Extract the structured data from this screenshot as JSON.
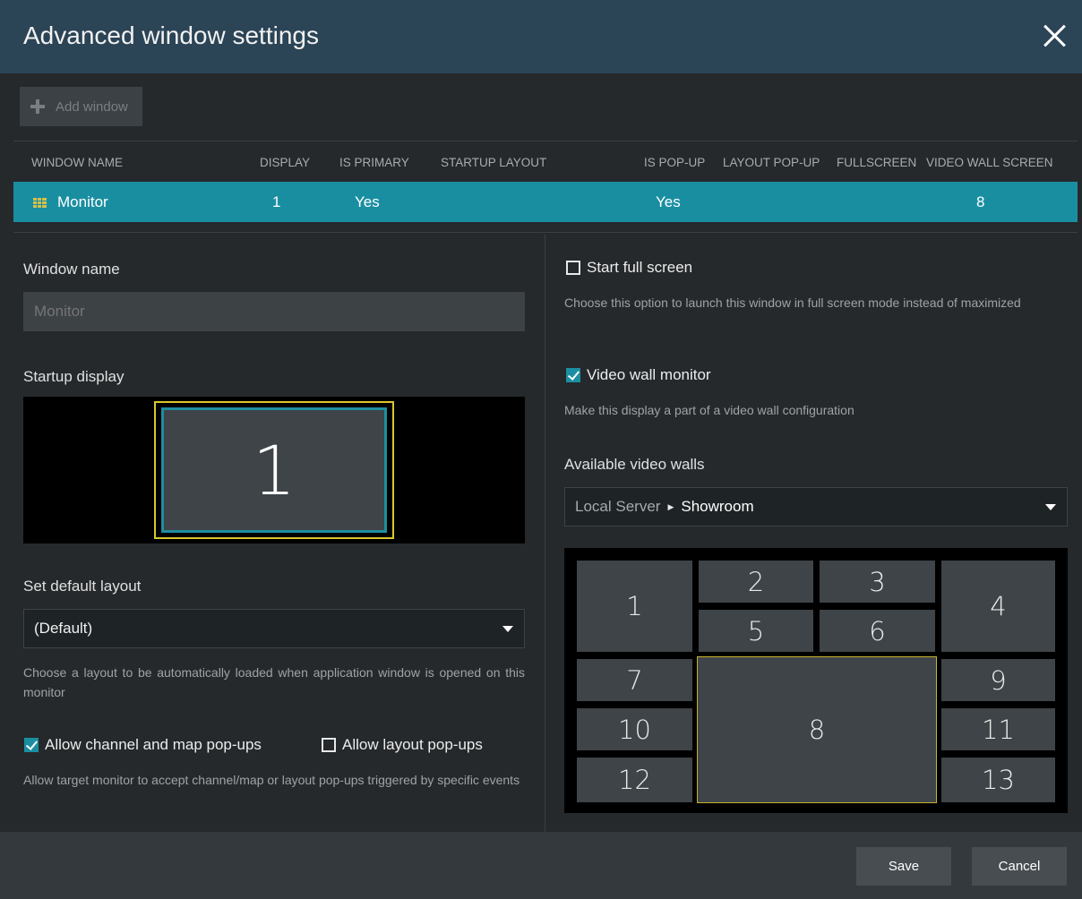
{
  "dialog": {
    "title": "Advanced window settings"
  },
  "toolbar": {
    "add_window_label": "Add window"
  },
  "table": {
    "headers": {
      "window_name": "WINDOW NAME",
      "display": "DISPLAY",
      "is_primary": "IS PRIMARY",
      "startup_layout": "STARTUP LAYOUT",
      "is_popup": "IS POP-UP",
      "layout_popup": "LAYOUT POP-UP",
      "fullscreen": "FULLSCREEN",
      "video_wall_screen": "VIDEO WALL SCREEN"
    },
    "row": {
      "window_name": "Monitor",
      "display": "1",
      "is_primary": "Yes",
      "startup_layout": "",
      "is_popup": "Yes",
      "layout_popup": "",
      "fullscreen": "",
      "video_wall_screen": "8"
    }
  },
  "left": {
    "window_name_label": "Window name",
    "window_name_placeholder": "Monitor",
    "startup_display_label": "Startup display",
    "startup_display_value": "1",
    "default_layout_label": "Set default layout",
    "default_layout_value": "(Default)",
    "default_layout_help": "Choose a layout to be automatically loaded when application window is opened on this monitor",
    "allow_channel_popups_label": "Allow channel and map pop-ups",
    "allow_channel_popups_checked": true,
    "allow_layout_popups_label": "Allow layout pop-ups",
    "allow_layout_popups_checked": false,
    "popups_help": "Allow target monitor to accept channel/map or layout pop-ups triggered by specific events"
  },
  "right": {
    "start_full_screen_label": "Start full screen",
    "start_full_screen_checked": false,
    "start_full_screen_help": "Choose this option to launch this window in full screen mode instead of maximized",
    "video_wall_monitor_label": "Video wall monitor",
    "video_wall_monitor_checked": true,
    "video_wall_monitor_help": "Make this display a part of a video wall configuration",
    "available_walls_label": "Available video walls",
    "server": "Local Server",
    "wall": "Showroom",
    "screens": [
      "1",
      "2",
      "3",
      "4",
      "5",
      "6",
      "7",
      "8",
      "9",
      "10",
      "11",
      "12",
      "13"
    ],
    "selected_screen": "8"
  },
  "footer": {
    "save_label": "Save",
    "cancel_label": "Cancel"
  },
  "colors": {
    "accent": "#1a8ea1",
    "selection": "#d9c82c",
    "titlebar": "#2b4456"
  }
}
